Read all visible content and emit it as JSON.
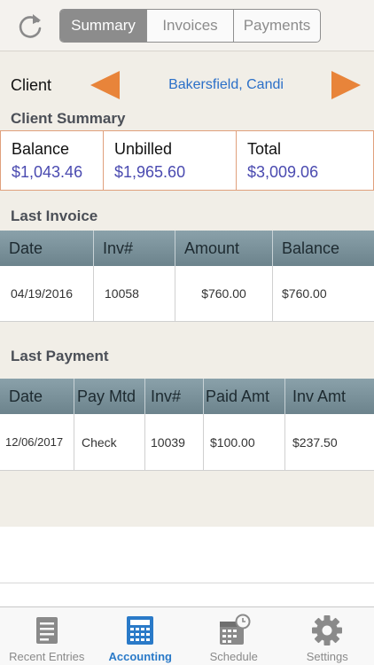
{
  "header": {
    "tabs": [
      {
        "label": "Summary",
        "active": true
      },
      {
        "label": "Invoices",
        "active": false
      },
      {
        "label": "Payments",
        "active": false
      }
    ]
  },
  "client": {
    "label": "Client",
    "name": "Bakersfield, Candi"
  },
  "client_summary": {
    "title": "Client Summary",
    "boxes": [
      {
        "label": "Balance",
        "value": "$1,043.46"
      },
      {
        "label": "Unbilled",
        "value": "$1,965.60"
      },
      {
        "label": "Total",
        "value": "$3,009.06"
      }
    ]
  },
  "last_invoice": {
    "title": "Last Invoice",
    "columns": [
      "Date",
      "Inv#",
      "Amount",
      "Balance"
    ],
    "row": [
      "04/19/2016",
      "10058",
      "$760.00",
      "$760.00"
    ]
  },
  "last_payment": {
    "title": "Last Payment",
    "columns": [
      "Date",
      "Pay Mtd",
      "Inv#",
      "Paid Amt",
      "Inv Amt"
    ],
    "row": [
      "12/06/2017",
      "Check",
      "10039",
      "$100.00",
      "$237.50"
    ]
  },
  "tabbar": {
    "items": [
      {
        "label": "Recent Entries",
        "icon": "document-icon",
        "active": false
      },
      {
        "label": "Accounting",
        "icon": "calculator-icon",
        "active": true
      },
      {
        "label": "Schedule",
        "icon": "calendar-clock-icon",
        "active": false
      },
      {
        "label": "Settings",
        "icon": "gear-icon",
        "active": false
      }
    ]
  },
  "colors": {
    "accent_orange": "#e8843a",
    "link_blue": "#2a6fc8",
    "value_purple": "#4a4ab0",
    "active_tab_blue": "#2a7ac8"
  }
}
